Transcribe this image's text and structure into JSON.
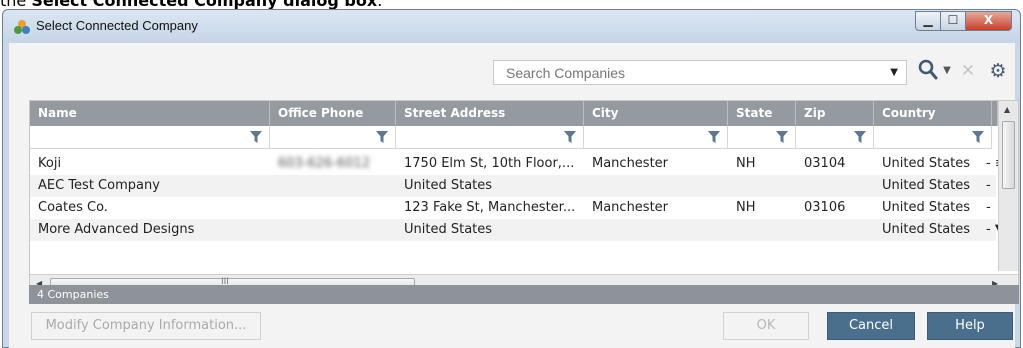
{
  "caption": {
    "prefix": "the ",
    "bold": "Select Connected Company dialog box",
    "suffix": "."
  },
  "window": {
    "title": "Select Connected Company",
    "minimize_glyph": "▁",
    "maximize_glyph": "☐",
    "close_glyph": "X"
  },
  "toolbar": {
    "search_placeholder": "Search Companies",
    "search_value": "",
    "dropdown_glyph": "▼",
    "clear_glyph": "✕",
    "gear_glyph": "⚙"
  },
  "grid": {
    "columns": [
      "Name",
      "Office Phone",
      "Street Address",
      "City",
      "State",
      "Zip",
      "Country"
    ],
    "rows": [
      {
        "name": "Koji",
        "phone": "603-626-6012",
        "street": "1750 Elm St, 10th Floor,...",
        "city": "Manchester",
        "state": "NH",
        "zip": "03104",
        "country": "United States",
        "extra": "- ≡"
      },
      {
        "name": "AEC Test Company",
        "phone": "",
        "street": "United States",
        "city": "",
        "state": "",
        "zip": "",
        "country": "United States",
        "extra": "-"
      },
      {
        "name": "Coates Co.",
        "phone": "",
        "street": "123 Fake St, Manchester...",
        "city": "Manchester",
        "state": "NH",
        "zip": "03106",
        "country": "United States",
        "extra": "-"
      },
      {
        "name": "More Advanced Designs",
        "phone": "",
        "street": "United States",
        "city": "",
        "state": "",
        "zip": "",
        "country": "United States",
        "extra": "- ▼"
      }
    ],
    "scroll_grip": "III",
    "status": "4 Companies"
  },
  "buttons": {
    "modify": "Modify Company Information...",
    "ok": "OK",
    "cancel": "Cancel",
    "help": "Help"
  },
  "colors": {
    "header_bg": "#949aa0",
    "primary_button": "#4a6f8c",
    "status_bar": "#8d9399"
  }
}
